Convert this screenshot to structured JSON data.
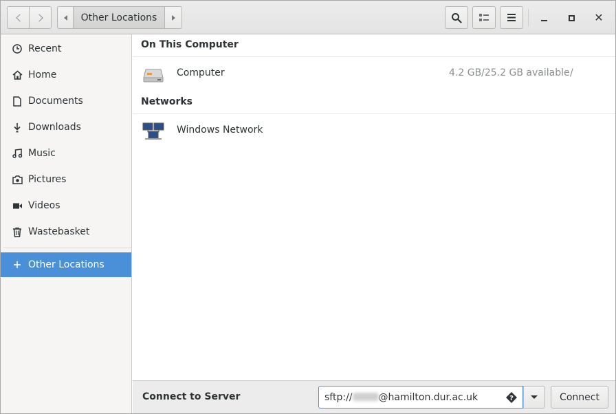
{
  "header": {
    "path_current": "Other Locations",
    "icons": {
      "back": "chevron-left-icon",
      "forward": "chevron-right-icon",
      "search": "search-icon",
      "view": "list-view-icon",
      "menu": "hamburger-menu-icon",
      "minimize": "minimize-icon",
      "maximize": "maximize-icon",
      "close": "close-icon"
    }
  },
  "sidebar": {
    "items": [
      {
        "label": "Recent",
        "icon": "clock-icon"
      },
      {
        "label": "Home",
        "icon": "home-icon"
      },
      {
        "label": "Documents",
        "icon": "document-icon"
      },
      {
        "label": "Downloads",
        "icon": "download-icon"
      },
      {
        "label": "Music",
        "icon": "music-icon"
      },
      {
        "label": "Pictures",
        "icon": "camera-icon"
      },
      {
        "label": "Videos",
        "icon": "video-icon"
      },
      {
        "label": "Wastebasket",
        "icon": "trash-icon"
      }
    ],
    "other_locations": {
      "label": "Other Locations",
      "icon": "plus-icon",
      "active": true
    }
  },
  "main": {
    "on_this_computer": {
      "heading": "On This Computer",
      "items": [
        {
          "name": "Computer",
          "info": "4.2 GB/25.2 GB available",
          "mount": "/",
          "icon": "drive-icon"
        }
      ]
    },
    "networks": {
      "heading": "Networks",
      "items": [
        {
          "name": "Windows Network",
          "icon": "network-icon"
        }
      ]
    }
  },
  "bottom": {
    "label": "Connect to Server",
    "server_prefix": "sftp://",
    "server_suffix": "@hamilton.dur.ac.uk",
    "connect_label": "Connect"
  },
  "colors": {
    "accent": "#4a90d9",
    "sidebar_bg": "#f6f5f4",
    "header_bg": "#e8e8e7"
  }
}
